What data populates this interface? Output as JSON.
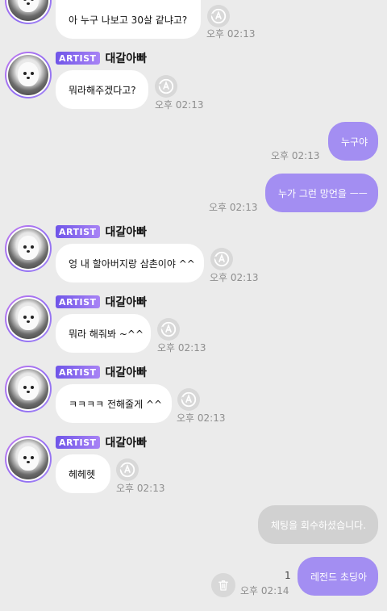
{
  "colors": {
    "background": "#ebebeb",
    "incoming_bubble": "#ffffff",
    "outgoing_bubble": "#a38ef2",
    "retracted_bubble": "#d1d1d1",
    "artist_badge": "#7b5cf0",
    "time_text": "#8e8e8e"
  },
  "icons": {
    "translate": "translate-icon",
    "trash": "trash-icon"
  },
  "messages": [
    {
      "direction": "in",
      "text": "아 누구 나보고 30살 같냐고?",
      "time": "오후 02:13"
    },
    {
      "direction": "in",
      "badge": "ARTIST",
      "sender": "대갈아빠",
      "text": "뭐라해주겠다고?",
      "time": "오후 02:13"
    },
    {
      "direction": "out",
      "text": "누구야",
      "time": "오후 02:13"
    },
    {
      "direction": "out",
      "text": "누가 그런 망언을 ㅡㅡ",
      "time": "오후 02:13"
    },
    {
      "direction": "in",
      "badge": "ARTIST",
      "sender": "대갈아빠",
      "text": "엉 내 할아버지랑 삼촌이야 ^^",
      "time": "오후 02:13"
    },
    {
      "direction": "in",
      "badge": "ARTIST",
      "sender": "대갈아빠",
      "text": "뭐라 해줘봐 ~^^",
      "time": "오후 02:13"
    },
    {
      "direction": "in",
      "badge": "ARTIST",
      "sender": "대갈아빠",
      "text": "ㅋㅋㅋㅋ 전해줄게 ^^",
      "time": "오후 02:13"
    },
    {
      "direction": "in",
      "badge": "ARTIST",
      "sender": "대갈아빠",
      "text": "헤헤헷",
      "time": "오후 02:13"
    },
    {
      "direction": "out",
      "retracted": true,
      "text": "체팅을 회수하셨습니다."
    },
    {
      "direction": "out",
      "text": "레전드 초딩아",
      "time": "오후 02:14",
      "unread_count": "1"
    }
  ]
}
